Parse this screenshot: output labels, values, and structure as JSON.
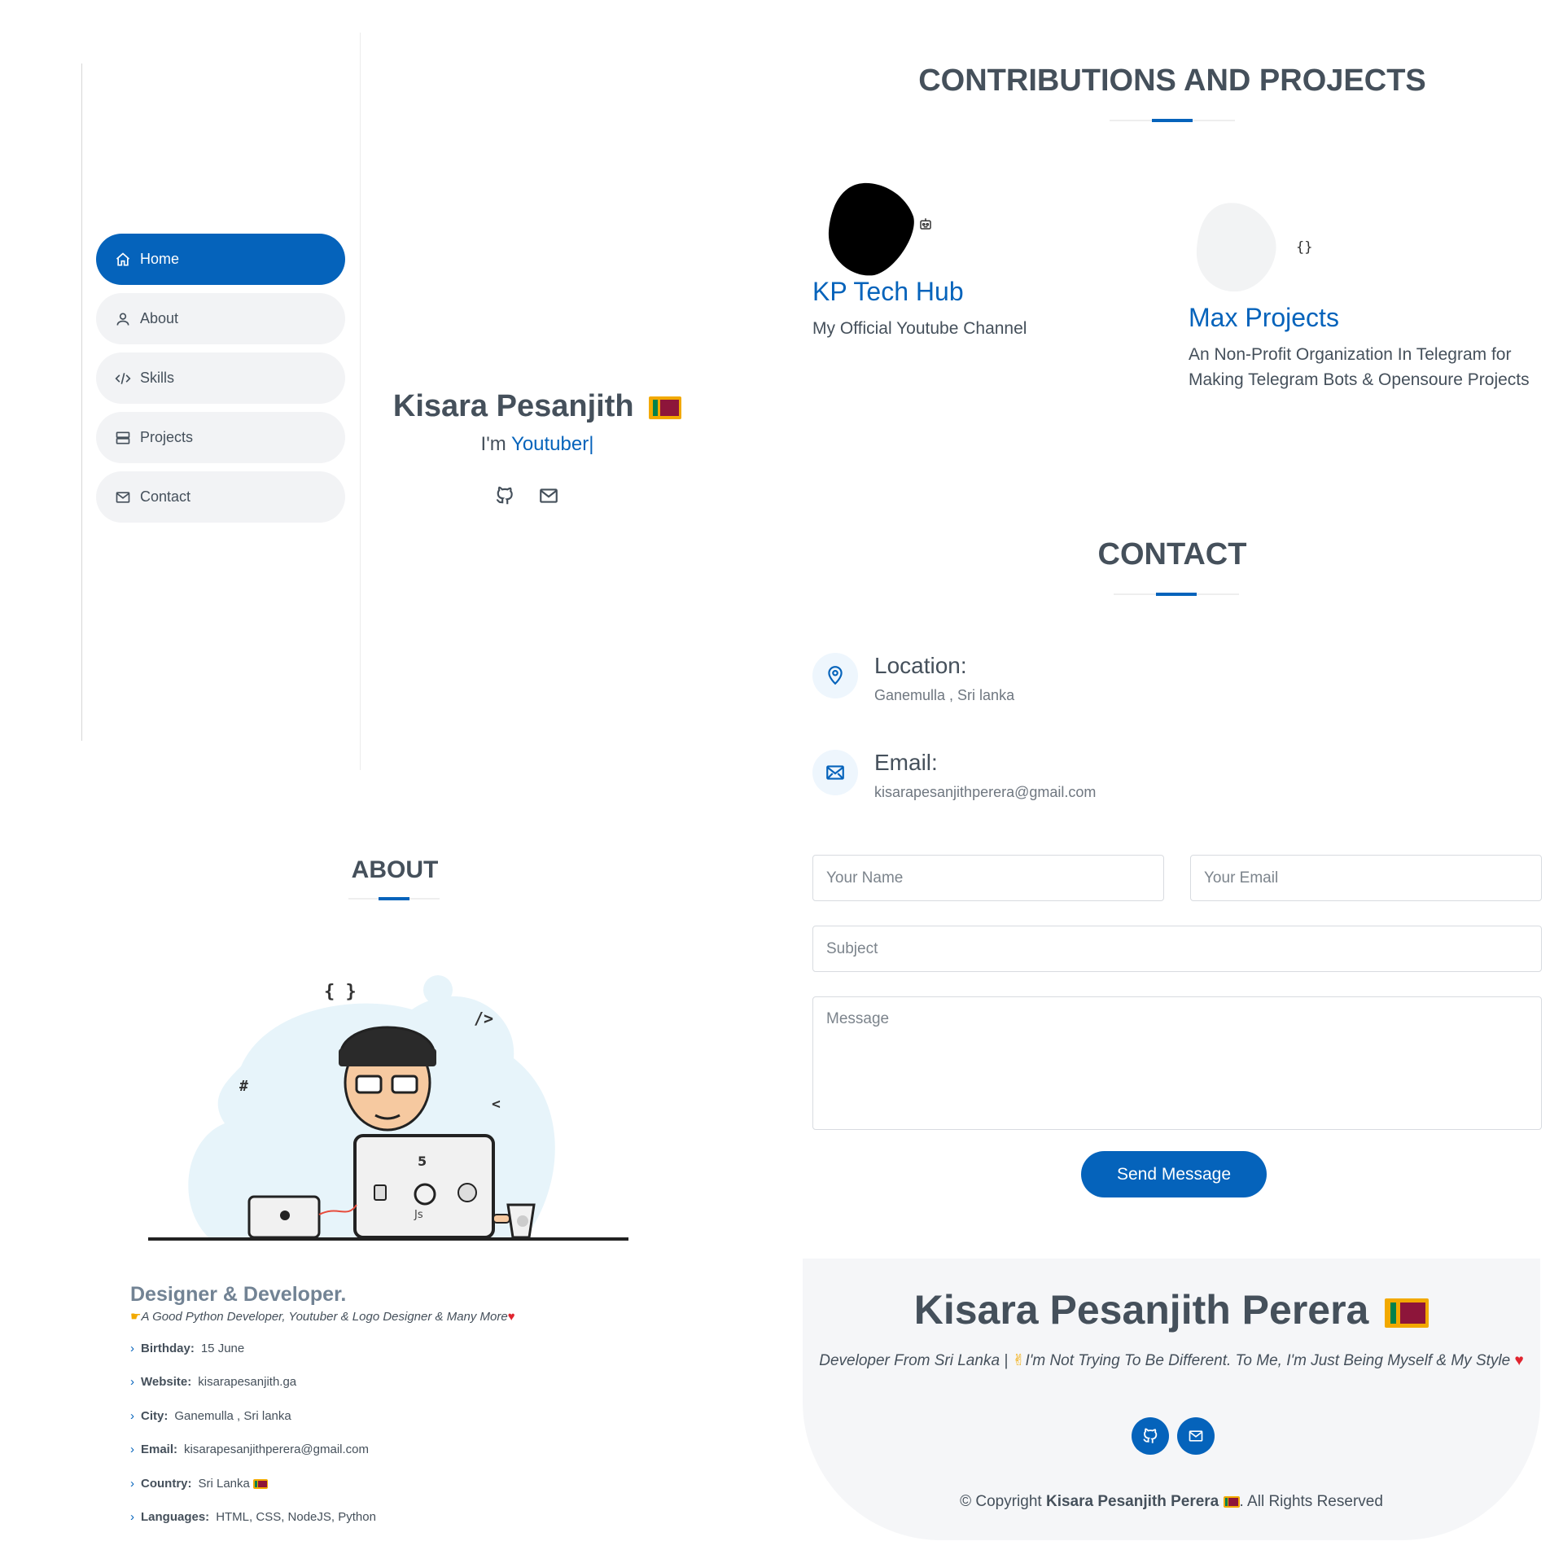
{
  "nav": [
    {
      "label": "Home",
      "icon": "home-icon",
      "active": true
    },
    {
      "label": "About",
      "icon": "user-icon"
    },
    {
      "label": "Skills",
      "icon": "code-icon"
    },
    {
      "label": "Projects",
      "icon": "server-icon"
    },
    {
      "label": "Contact",
      "icon": "envelope-icon"
    }
  ],
  "hero": {
    "name": "Kisara Pesanjith",
    "prefix": "I'm",
    "typed": "Youtuber|",
    "social": [
      "github-icon",
      "envelope-icon"
    ]
  },
  "projects": {
    "title": "CONTRIBUTIONS AND PROJECTS",
    "items": [
      {
        "title": "KP Tech Hub",
        "desc": "My Official Youtube Channel",
        "icon": "robot-icon"
      },
      {
        "title": "Max Projects",
        "desc": "An Non-Profit Organization In Telegram for Making Telegram Bots & Opensoure Projects",
        "icon": "braces-icon"
      }
    ]
  },
  "contact": {
    "title": "CONTACT",
    "location_label": "Location:",
    "location_value": "Ganemulla , Sri lanka",
    "email_label": "Email:",
    "email_value": "kisarapesanjithperera@gmail.com",
    "form": {
      "name_placeholder": "Your Name",
      "email_placeholder": "Your Email",
      "subject_placeholder": "Subject",
      "message_placeholder": "Message",
      "submit": "Send Message"
    }
  },
  "about": {
    "title": "ABOUT",
    "heading": "Designer & Developer.",
    "tagline": "A Good Python Developer, Youtuber & Logo Designer & Many More",
    "details": [
      {
        "label": "Birthday:",
        "value": "15 June"
      },
      {
        "label": "Website:",
        "value": "kisarapesanjith.ga"
      },
      {
        "label": "City:",
        "value": "Ganemulla , Sri lanka"
      },
      {
        "label": "Email:",
        "value": "kisarapesanjithperera@gmail.com"
      },
      {
        "label": "Country:",
        "value": "Sri Lanka",
        "flag": true
      },
      {
        "label": "Languages:",
        "value": "HTML, CSS, NodeJS, Python"
      }
    ],
    "illustration_glyphs": [
      "{ }",
      "/>",
      "#",
      "<",
      "5",
      "Js"
    ]
  },
  "footer": {
    "name": "Kisara Pesanjith Perera",
    "quote_part1": "Developer From Sri Lanka |",
    "quote_part2": "I'm Not Trying To Be Different. To Me, I'm Just Being Myself & My Style",
    "copyright_prefix": "© Copyright",
    "copyright_name": "Kisara Pesanjith Perera",
    "copyright_suffix": ". All Rights Reserved"
  },
  "colors": {
    "accent": "#0563bb",
    "text": "#45505b",
    "muted": "#728394"
  }
}
